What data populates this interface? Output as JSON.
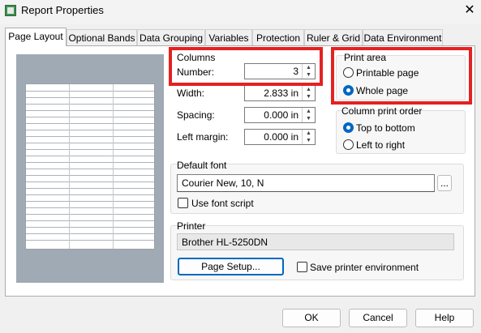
{
  "window": {
    "title": "Report Properties",
    "close_glyph": "✕"
  },
  "tabs": [
    {
      "label": "Page Layout",
      "active": true
    },
    {
      "label": "Optional Bands",
      "active": false
    },
    {
      "label": "Data Grouping",
      "active": false
    },
    {
      "label": "Variables",
      "active": false
    },
    {
      "label": "Protection",
      "active": false
    },
    {
      "label": "Ruler & Grid",
      "active": false
    },
    {
      "label": "Data Environment",
      "active": false
    }
  ],
  "columns": {
    "group_label": "Columns",
    "number_label": "Number:",
    "number_value": "3",
    "width_label": "Width:",
    "width_value": "2.833 in",
    "spacing_label": "Spacing:",
    "spacing_value": "0.000 in",
    "left_margin_label": "Left margin:",
    "left_margin_value": "0.000 in"
  },
  "print_area": {
    "label": "Print area",
    "options": [
      {
        "label": "Printable page",
        "checked": false
      },
      {
        "label": "Whole page",
        "checked": true
      }
    ]
  },
  "column_print_order": {
    "label": "Column print order",
    "options": [
      {
        "label": "Top to bottom",
        "checked": true
      },
      {
        "label": "Left to right",
        "checked": false
      }
    ]
  },
  "default_font": {
    "label": "Default font",
    "value": "Courier New, 10, N",
    "browse_label": "...",
    "use_font_script_label": "Use font script",
    "use_font_script_checked": false
  },
  "printer": {
    "label": "Printer",
    "name": "Brother HL-5250DN",
    "page_setup_label": "Page Setup...",
    "save_env_label": "Save printer environment",
    "save_env_checked": false
  },
  "buttons": {
    "ok": "OK",
    "cancel": "Cancel",
    "help": "Help"
  },
  "icons": {
    "app": "report-icon",
    "close": "close-icon",
    "spin_up": "spin-up-icon",
    "spin_down": "spin-down-icon",
    "up_glyph": "▲",
    "down_glyph": "▼"
  },
  "colors": {
    "highlight": "#e32222",
    "accent": "#0067c0",
    "preview_bg": "#a0aab4"
  }
}
